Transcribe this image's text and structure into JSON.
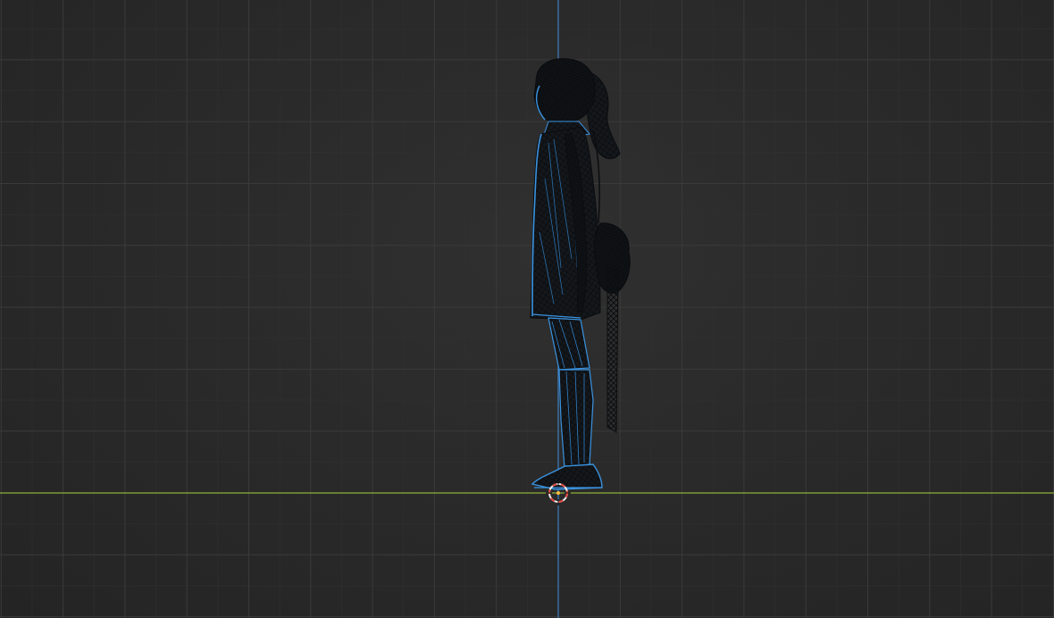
{
  "viewport": {
    "view": "side-orthographic-wireframe",
    "colors": {
      "background": "#2a2a2a",
      "grid_minor": "#303030",
      "grid_major": "#3a3a3a",
      "axis_x": "#8fb13a",
      "axis_z": "#3f7fc1",
      "wire_edge": "#3a93e0",
      "mesh_fill": "#121519",
      "mesh_wire": "#0a0c0f",
      "cursor_ring": "#e0463c",
      "cursor_ring_alt": "#f0f0f0"
    },
    "icons": {
      "cursor": "3d-cursor-icon",
      "object_origin": "origin-dot-icon"
    }
  }
}
